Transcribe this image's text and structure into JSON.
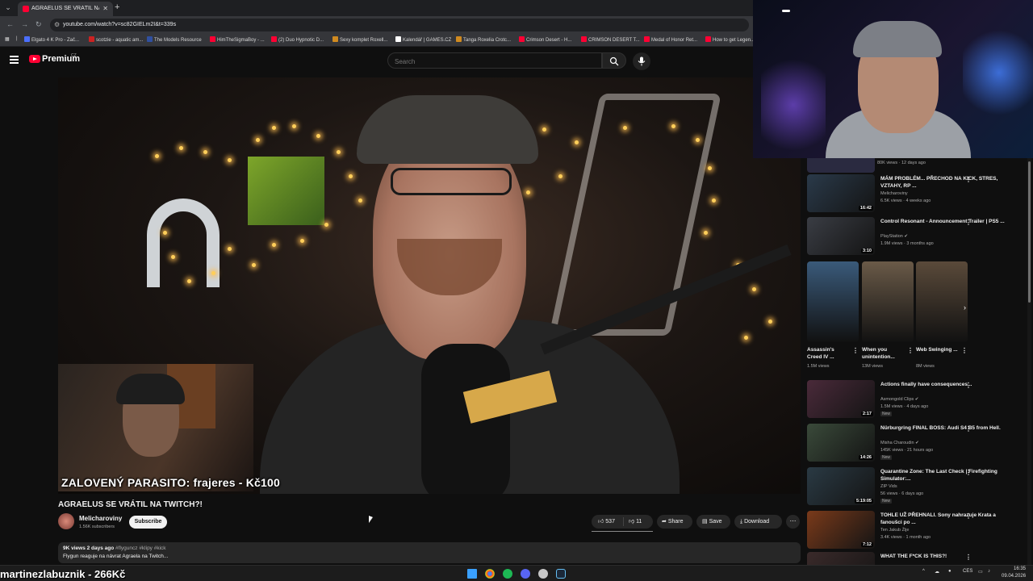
{
  "browser": {
    "tab_title": "AGRAELUS SE VRÁTIL NA TWIT",
    "url": "youtube.com/watch?v=sc82GIELm2I&t=339s",
    "bookmarks": [
      {
        "label": "Elgato 4 K Pro - Zač...",
        "color": "#4b6fff"
      },
      {
        "label": "scotzie - aquatic am...",
        "color": "#cc2222"
      },
      {
        "label": "The Models Resource",
        "color": "#3050a0"
      },
      {
        "label": "HimTheSigmaBoy - ...",
        "color": "#ff0033"
      },
      {
        "label": "(2) Duo Hypnotic D...",
        "color": "#ff0033"
      },
      {
        "label": "Sexy komplet Roxell...",
        "color": "#d08a20"
      },
      {
        "label": "Kalendář | GAMES.CZ",
        "color": "#ffffff"
      },
      {
        "label": "Tanga Roxelia Crotc...",
        "color": "#d08a20"
      },
      {
        "label": "Crimson Desert - H...",
        "color": "#ff0033"
      },
      {
        "label": "CRIMSON DESERT T...",
        "color": "#ff0033"
      },
      {
        "label": "Medal of Honor Ret...",
        "color": "#ff0033"
      },
      {
        "label": "How to get Legen...",
        "color": "#ff0033"
      }
    ]
  },
  "youtube": {
    "brand": "Premium",
    "brand_country": "CZ",
    "search_placeholder": "Search"
  },
  "video": {
    "overlay_text": "ZALOVENÝ PARASITO: frajeres - Kč100",
    "title": "AGRAELUS SE VRÁTIL NA TWITCH?!",
    "channel": "Melicharoviny",
    "subscribers": "1.56K subscribers",
    "subscribe_label": "Subscribe",
    "likes": "537",
    "dislikes": "11",
    "share_label": "Share",
    "save_label": "Save",
    "download_label": "Download",
    "views_date": "9K views  2 days ago",
    "hashtags": "#flyguncz #klipy #kick",
    "description": "Flygun reaguje na návrat Agraela na Twitch..."
  },
  "sidebar": {
    "top_meta": "80K views · 12 days ago",
    "recs": [
      {
        "title": "MÁM PROBLÉM... PŘECHOD NA KICK, STRES, VZTAHY, RP ...",
        "channel": "Melicharoviny",
        "meta": "6.5K views · 4 weeks ago",
        "duration": "16:42",
        "verified": false,
        "badge": "",
        "thumb": "#2a3a4a"
      },
      {
        "title": "Control Resonant - Announcement Trailer | PS5 ...",
        "channel": "PlayStation",
        "meta": "1.9M views · 3 months ago",
        "duration": "3:10",
        "verified": true,
        "badge": "",
        "thumb": "#3a3d44"
      }
    ],
    "shorts": [
      {
        "title": "Assassin's Creed IV ...",
        "views": "1.5M views",
        "thumb": "#3a5a7a"
      },
      {
        "title": "When you unintention...",
        "views": "13M views",
        "thumb": "#6a5a48"
      },
      {
        "title": "Web Swinging ...",
        "views": "8M views",
        "thumb": "#5a4a3a"
      }
    ],
    "recs2": [
      {
        "title": "Actions finally have consequences...",
        "channel": "Asmongold Clips",
        "meta": "1.5M views · 4 days ago",
        "duration": "2:17",
        "verified": true,
        "badge": "New",
        "thumb": "#4a2a3a"
      },
      {
        "title": "Nürburgring FINAL BOSS: Audi S4 B5 from Hell.",
        "channel": "Misha Charoudin",
        "meta": "145K views · 21 hours ago",
        "duration": "14:26",
        "verified": true,
        "badge": "New",
        "thumb": "#3a4a3a"
      },
      {
        "title": "Quarantine Zone: The Last Check | Firefighting Simulator:...",
        "channel": "ZIP Vids",
        "meta": "56 views · 6 days ago",
        "duration": "5:19:05",
        "verified": false,
        "badge": "New",
        "thumb": "#2a3a44"
      },
      {
        "title": "TOHLE UŽ PŘEHNALI. Sony nahrazuje Krata a fanoušci po ...",
        "channel": "Ten Jakub Žije",
        "meta": "3.4K views · 1 month ago",
        "duration": "7:12",
        "verified": false,
        "badge": "",
        "thumb": "#7a3a1a"
      },
      {
        "title": "WHAT THE F*CK IS THIS?!",
        "channel": "",
        "meta": "",
        "duration": "",
        "verified": false,
        "badge": "",
        "thumb": "#3a2a2a"
      }
    ]
  },
  "stream": {
    "donation_text": "martinezlabuznik - 266Kč"
  },
  "taskbar": {
    "lang": "CES",
    "time": "16:35",
    "date": "09.04.2026"
  }
}
